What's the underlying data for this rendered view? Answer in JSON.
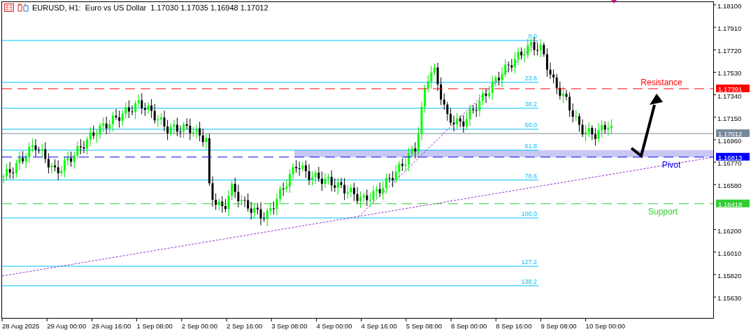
{
  "chart": {
    "symbol_info": "EURUSD, H1:  Euro vs US Dollar  1.17030 1.17035 1.16948 1.17012",
    "price_axis": [
      "1.18100",
      "1.17910",
      "1.17720",
      "1.17530",
      "1.17340",
      "1.17150",
      "1.16960",
      "1.16770",
      "1.16580",
      "1.16200",
      "1.16010",
      "1.15820",
      "1.15630"
    ],
    "time_axis": [
      "28 Aug 2025",
      "29 Aug 00:00",
      "29 Aug 16:00",
      "1 Sep 08:00",
      "2 Sep 00:00",
      "2 Sep 16:00",
      "3 Sep 08:00",
      "4 Sep 00:00",
      "4 Sep 16:00",
      "5 Sep 08:00",
      "8 Sep 00:00",
      "8 Sep 16:00",
      "9 Sep 08:00",
      "10 Sep 00:00"
    ],
    "fibonacci": {
      "levels": [
        "0.0",
        "23.6",
        "38.2",
        "50.0",
        "61.8",
        "78.6",
        "100.0",
        "127.2",
        "138.2"
      ]
    },
    "horizontal_lines": [
      {
        "label": "Resistance",
        "price_tag": "1.17391",
        "color": "#ff0000"
      },
      {
        "label": "Pivot",
        "price_tag": "1.16813",
        "color": "#0000ff"
      },
      {
        "label": "Support",
        "price_tag": "1.16418",
        "color": "#32cd32"
      }
    ],
    "current_price": {
      "price_tag": "1.17012"
    }
  }
}
